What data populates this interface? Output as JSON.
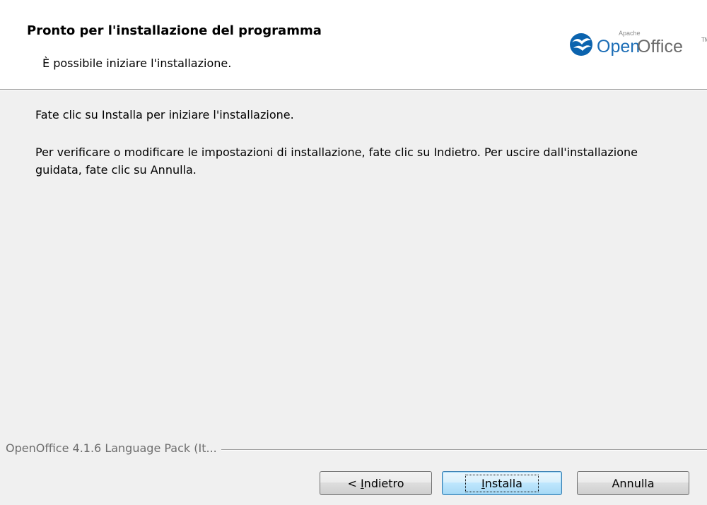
{
  "header": {
    "title": "Pronto per l'installazione del programma",
    "subtitle": "È possibile iniziare l'installazione."
  },
  "logo": {
    "small_text": "Apache",
    "brand_part1": "Open",
    "brand_part2": "Office",
    "trademark": "TM",
    "brand_colors": {
      "open": "#1b6db6",
      "office": "#6a6a6a",
      "gull": "#0b63ae"
    }
  },
  "body": {
    "instruction": "Fate clic su Installa per iniziare l'installazione.",
    "note": "Per verificare o modificare le impostazioni di installazione, fate clic su Indietro. Per uscire dall'installazione guidata, fate clic su Annulla."
  },
  "footer": {
    "product_label": "OpenOffice 4.1.6 Language Pack (It..."
  },
  "buttons": {
    "back": {
      "prefix": "< ",
      "mnemonic": "I",
      "rest": "ndietro"
    },
    "install": {
      "mnemonic": "I",
      "rest": "nstalla"
    },
    "cancel": {
      "label": "Annulla"
    }
  }
}
